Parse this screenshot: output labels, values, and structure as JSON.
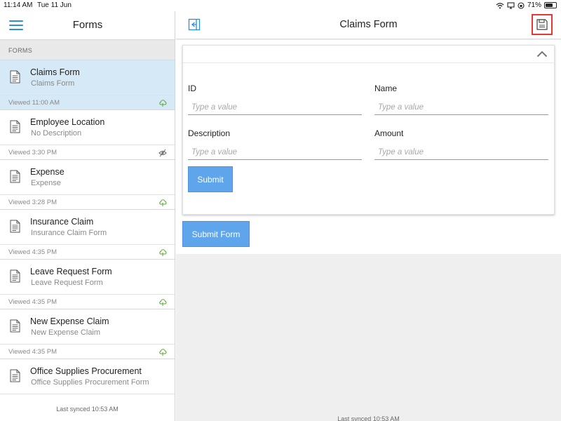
{
  "status_bar": {
    "time": "11:14 AM",
    "date": "Tue 11 Jun",
    "battery": "71%",
    "battery_level": 0.71
  },
  "sidebar": {
    "title": "Forms",
    "section_label": "FORMS",
    "footer": "Last synced 10:53 AM",
    "items": [
      {
        "name": "Claims Form",
        "description": "Claims Form",
        "viewed": "Viewed 11:00 AM",
        "status_icon": "cloud-synced-icon",
        "selected": true
      },
      {
        "name": "Employee Location",
        "description": "No Description",
        "viewed": "Viewed 3:30 PM",
        "status_icon": "sync-disabled-icon",
        "selected": false
      },
      {
        "name": "Expense",
        "description": "Expense",
        "viewed": "Viewed 3:28 PM",
        "status_icon": "cloud-synced-icon",
        "selected": false
      },
      {
        "name": "Insurance Claim",
        "description": "Insurance Claim Form",
        "viewed": "Viewed 4:35 PM",
        "status_icon": "cloud-synced-icon",
        "selected": false
      },
      {
        "name": "Leave Request Form",
        "description": "Leave Request Form",
        "viewed": "Viewed 4:35 PM",
        "status_icon": "cloud-synced-icon",
        "selected": false
      },
      {
        "name": "New Expense Claim",
        "description": "New Expense Claim",
        "viewed": "Viewed 4:35 PM",
        "status_icon": "cloud-synced-icon",
        "selected": false
      },
      {
        "name": "Office Supplies Procurement",
        "description": "Office Supplies Procurement Form",
        "viewed": "",
        "status_icon": "",
        "selected": false
      }
    ]
  },
  "main": {
    "title": "Claims Form",
    "fields": {
      "id": {
        "label": "ID",
        "placeholder": "Type a value",
        "value": ""
      },
      "name": {
        "label": "Name",
        "placeholder": "Type a value",
        "value": ""
      },
      "description": {
        "label": "Description",
        "placeholder": "Type a value",
        "value": ""
      },
      "amount": {
        "label": "Amount",
        "placeholder": "Type a value",
        "value": ""
      }
    },
    "submit_label": "Submit",
    "submit_form_label": "Submit Form",
    "footer": "Last synced 10:53 AM"
  },
  "colors": {
    "accent": "#2a8fd8",
    "button": "#5ea5ec",
    "selected_row": "#d6e9f6",
    "sync_green": "#5aa832",
    "highlight_red": "#e53935"
  }
}
